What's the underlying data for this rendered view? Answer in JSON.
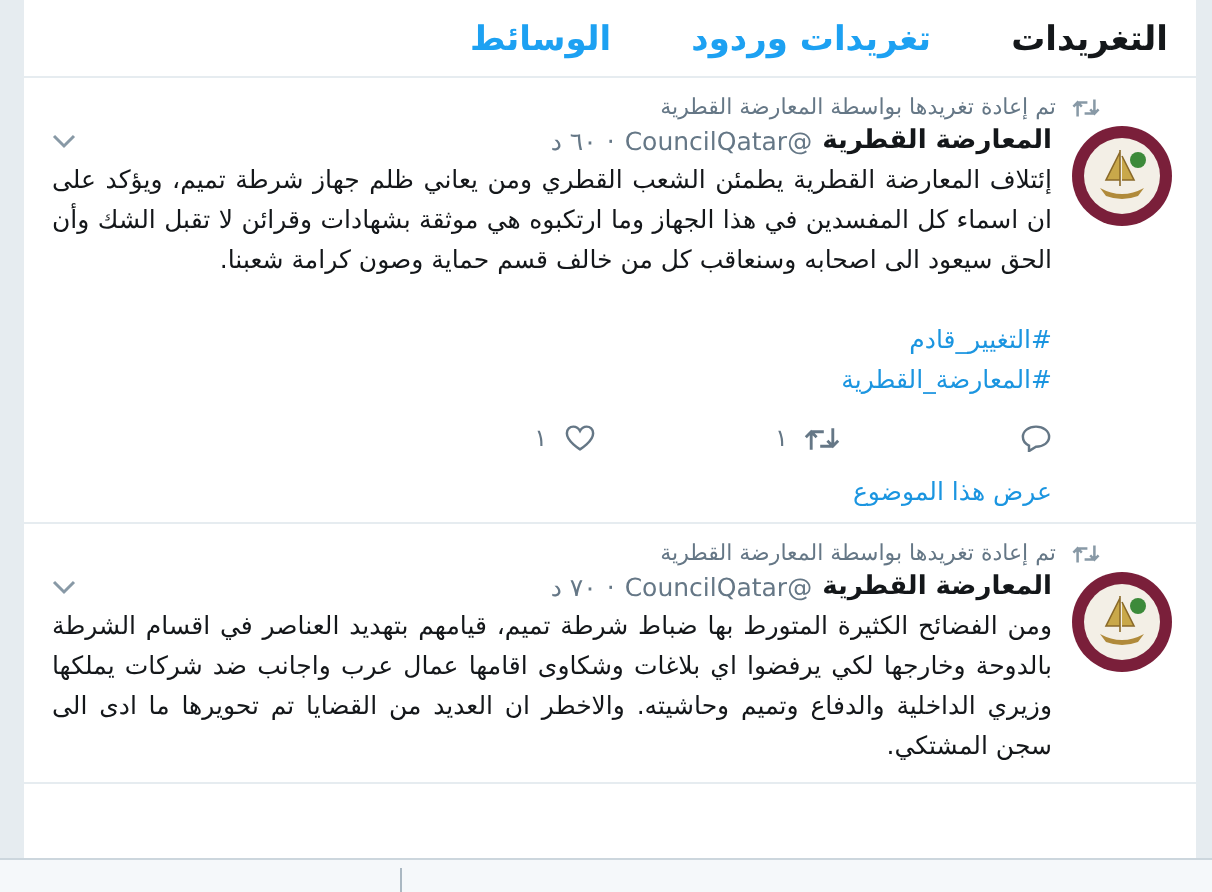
{
  "tabs": [
    {
      "label": "التغريدات",
      "selected": true
    },
    {
      "label": "تغريدات وردود",
      "selected": false
    },
    {
      "label": "الوسائط",
      "selected": false
    }
  ],
  "tweets": [
    {
      "retweeted_by": "تم إعادة تغريدها بواسطة المعارضة القطرية",
      "name": "المعارضة القطرية",
      "handle": "@CouncilQatar",
      "separator": "·",
      "time": "٦٠ د",
      "text": "إئتلاف المعارضة القطرية يطمئن الشعب القطري ومن يعاني ظلم جهاز شرطة تميم، ويؤكد على ان اسماء كل المفسدين في هذا الجهاز وما ارتكبوه هي موثقة بشهادات وقرائن لا تقبل الشك وأن الحق سيعود الى اصحابه وسنعاقب كل من خالف قسم حماية وصون كرامة شعبنا.",
      "hashtags": [
        "#التغيير_قادم",
        "#المعارضة_القطرية"
      ],
      "retweets": "١",
      "likes": "١",
      "thread_link": "عرض هذا الموضوع"
    },
    {
      "retweeted_by": "تم إعادة تغريدها بواسطة المعارضة القطرية",
      "name": "المعارضة القطرية",
      "handle": "@CouncilQatar",
      "separator": "·",
      "time": "٧٠ د",
      "text": "ومن الفضائح الكثيرة المتورط بها ضباط شرطة تميم، قيامهم بتهديد العناصر في اقسام الشرطة بالدوحة وخارجها لكي يرفضوا اي بلاغات وشكاوى اقامها عمال عرب واجانب ضد شركات يملكها وزيري الداخلية والدفاع وتميم وحاشيته. والاخطر ان العديد من القضايا تم تحويرها ما ادى الى سجن المشتكي."
    }
  ]
}
